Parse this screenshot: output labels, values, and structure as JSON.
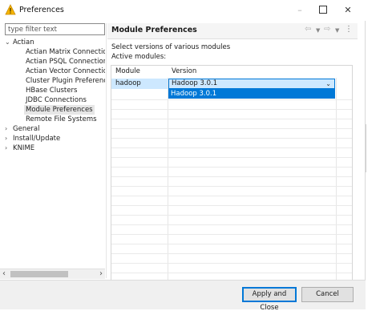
{
  "window": {
    "title": "Preferences"
  },
  "filter": {
    "placeholder": "type filter text"
  },
  "tree": {
    "nodes": [
      {
        "label": "Actian",
        "twisty": "⌄"
      },
      {
        "label": "Actian Matrix Connectio"
      },
      {
        "label": "Actian PSQL Connection"
      },
      {
        "label": "Actian Vector Connectio"
      },
      {
        "label": "Cluster Plugin Preferenc"
      },
      {
        "label": "HBase Clusters"
      },
      {
        "label": "JDBC Connections"
      },
      {
        "label": "Module Preferences"
      },
      {
        "label": "Remote File Systems"
      },
      {
        "label": "General",
        "twisty": "›"
      },
      {
        "label": "Install/Update",
        "twisty": "›"
      },
      {
        "label": "KNIME",
        "twisty": "›"
      }
    ]
  },
  "page": {
    "title": "Module Preferences",
    "description": "Select versions of various modules",
    "active_label": "Active modules:"
  },
  "table": {
    "headers": [
      "Module",
      "Version"
    ],
    "rows": [
      {
        "module": "hadoop",
        "version": "Hadoop 3.0.1"
      }
    ],
    "dropdown_options": [
      "Hadoop 3.0.1"
    ]
  },
  "buttons": {
    "apply": "Apply and Close",
    "cancel": "Cancel"
  },
  "colors": {
    "selection": "#0078d7",
    "row_highlight": "#cde8ff"
  }
}
